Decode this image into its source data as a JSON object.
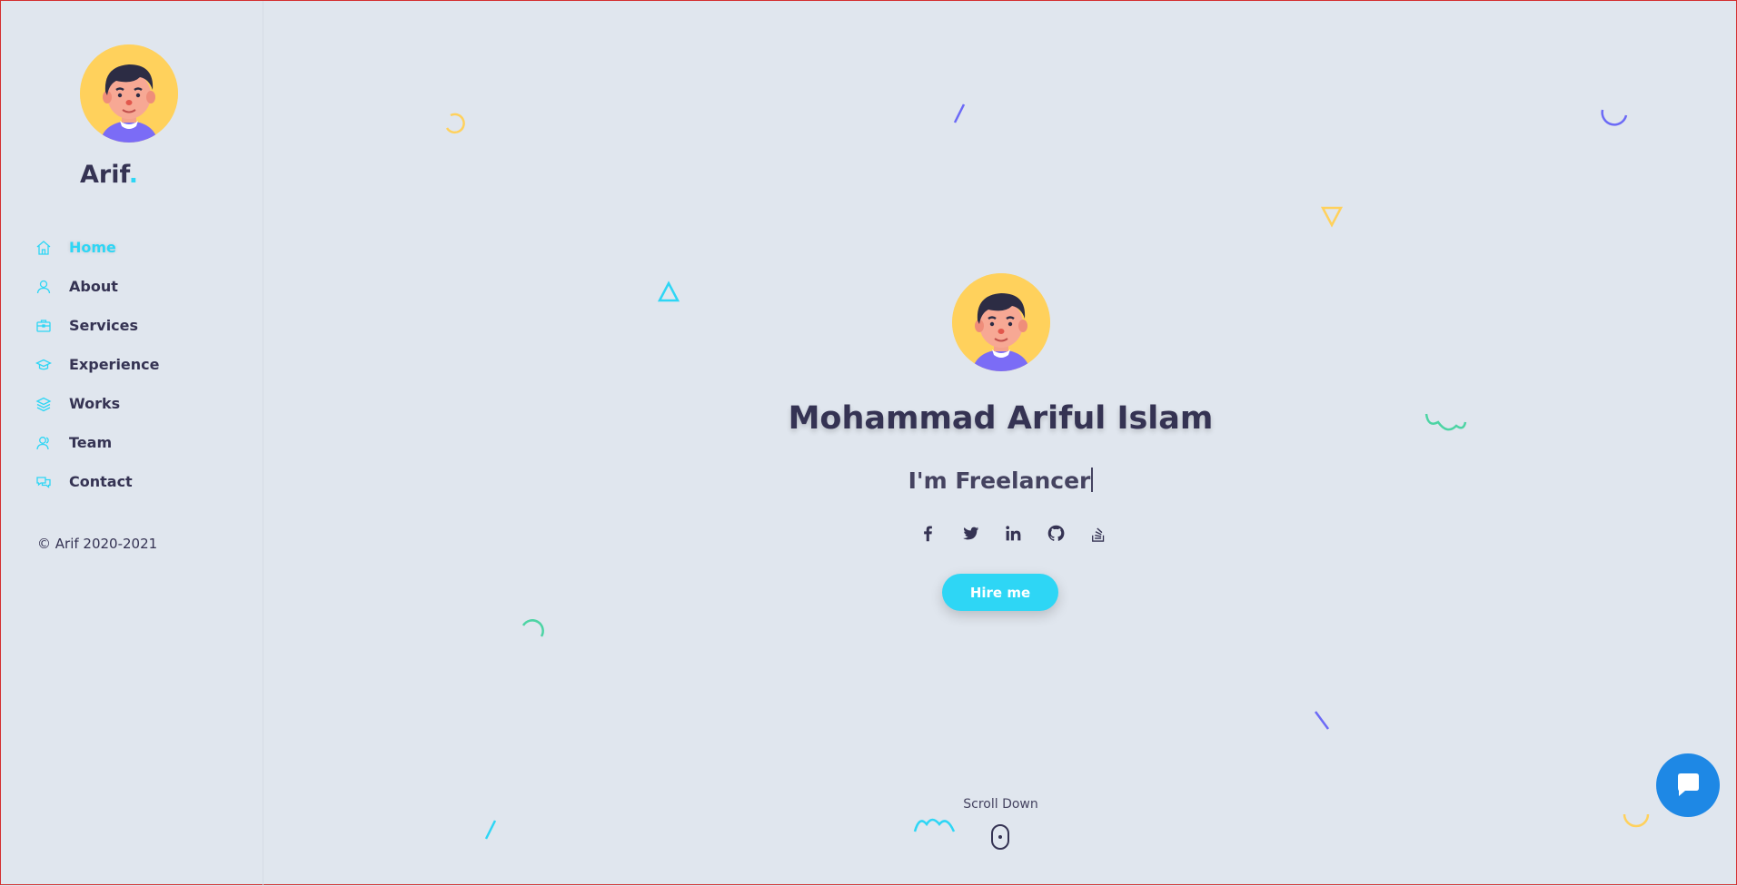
{
  "colors": {
    "background": "#e0e6ee",
    "accent": "#2ed6f5",
    "text": "#353353",
    "avatar_bg": "#ffd15c",
    "chat": "#1e88e5"
  },
  "sidebar": {
    "brand_name": "Arif",
    "brand_dot": ".",
    "nav": [
      {
        "label": "Home",
        "icon": "home-icon",
        "active": true
      },
      {
        "label": "About",
        "icon": "user-icon",
        "active": false
      },
      {
        "label": "Services",
        "icon": "briefcase-icon",
        "active": false
      },
      {
        "label": "Experience",
        "icon": "graduation-cap-icon",
        "active": false
      },
      {
        "label": "Works",
        "icon": "layers-icon",
        "active": false
      },
      {
        "label": "Team",
        "icon": "team-icon",
        "active": false
      },
      {
        "label": "Contact",
        "icon": "chat-bubbles-icon",
        "active": false
      }
    ],
    "copyright": "© Arif 2020-2021"
  },
  "hero": {
    "name": "Mohammad Ariful Islam",
    "role": "I'm Freelancer",
    "socials": [
      "facebook-icon",
      "twitter-icon",
      "linkedin-icon",
      "github-icon",
      "stackoverflow-icon"
    ],
    "hire_label": "Hire me",
    "scroll_label": "Scroll Down"
  },
  "chat": {
    "icon": "chat-icon"
  }
}
